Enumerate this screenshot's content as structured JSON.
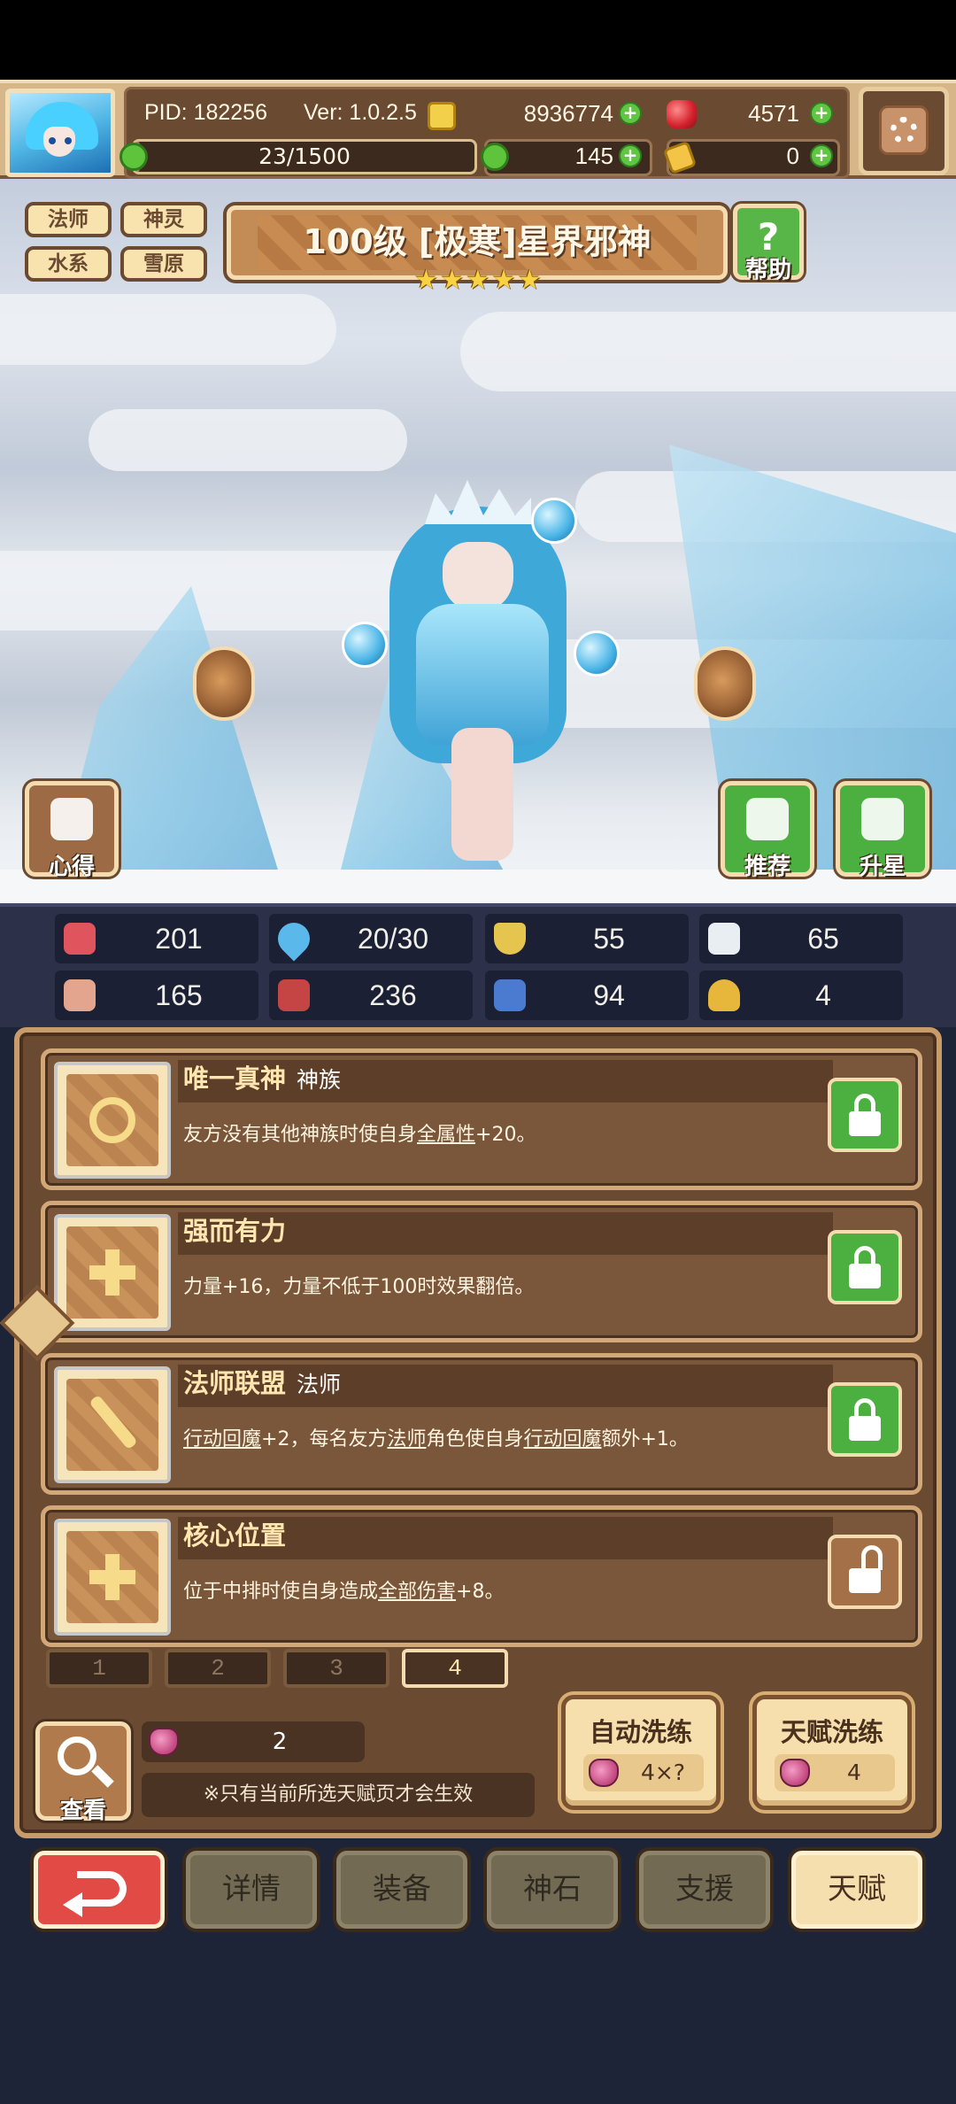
{
  "player": {
    "pid": "PID: 182256",
    "version": "Ver: 1.0.2.5",
    "xp": "23/1500",
    "xp_progress": 0.0153
  },
  "resources": {
    "gold": "8936774",
    "gems": "4571",
    "clover": "145",
    "tickets": "0"
  },
  "hero": {
    "tags": [
      "法师",
      "神灵",
      "水系",
      "雪原"
    ],
    "title": "100级 [极寒]星界邪神",
    "stars": 5,
    "help_label": "帮助",
    "notes_label": "心得",
    "recommend_label": "推荐",
    "upgrade_label": "升星"
  },
  "stats": [
    {
      "icon": "heart-icon",
      "value": "201"
    },
    {
      "icon": "mana-drop-icon",
      "value": "20/30"
    },
    {
      "icon": "shield-icon",
      "value": "55"
    },
    {
      "icon": "wing-icon",
      "value": "65"
    },
    {
      "icon": "fist-icon",
      "value": "165"
    },
    {
      "icon": "book-icon",
      "value": "236"
    },
    {
      "icon": "boot-icon",
      "value": "94"
    },
    {
      "icon": "horseshoe-icon",
      "value": "4"
    }
  ],
  "talents": [
    {
      "title": "唯一真神",
      "subtitle": "神族",
      "desc_parts": [
        "友方没有其他神族时使自身",
        "全属性",
        "+20。"
      ],
      "locked": true,
      "emblem": "sun-emblem-icon"
    },
    {
      "title": "强而有力",
      "subtitle": "",
      "desc_parts": [
        "力量+16，力量不低于100时效果翻倍。"
      ],
      "locked": true,
      "emblem": "cross-emblem-icon"
    },
    {
      "title": "法师联盟",
      "subtitle": "法师",
      "desc_parts": [
        "行动回魔",
        "+2，每名友方",
        "法师",
        "角色使自身",
        "行动回魔",
        "额外+1。"
      ],
      "locked": true,
      "emblem": "staff-emblem-icon"
    },
    {
      "title": "核心位置",
      "subtitle": "",
      "desc_parts": [
        "位于中排时使自身造成",
        "全部伤害",
        "+8。"
      ],
      "locked": false,
      "emblem": "cross-emblem-icon"
    }
  ],
  "pages": [
    "1",
    "2",
    "3",
    "4"
  ],
  "active_page": 4,
  "bottom": {
    "view_label": "查看",
    "seed_count": "2",
    "note": "※只有当前所选天赋页才会生效",
    "auto_wash_label": "自动洗练",
    "auto_wash_cost": "4×?",
    "talent_wash_label": "天赋洗练",
    "talent_wash_cost": "4"
  },
  "nav": [
    "详情",
    "装备",
    "神石",
    "支援",
    "天赋"
  ],
  "colors": {
    "panel_brown": "#6b4a32",
    "accent_cream": "#f6dfad",
    "lock_green": "#4bb040",
    "back_red": "#e24a45"
  }
}
